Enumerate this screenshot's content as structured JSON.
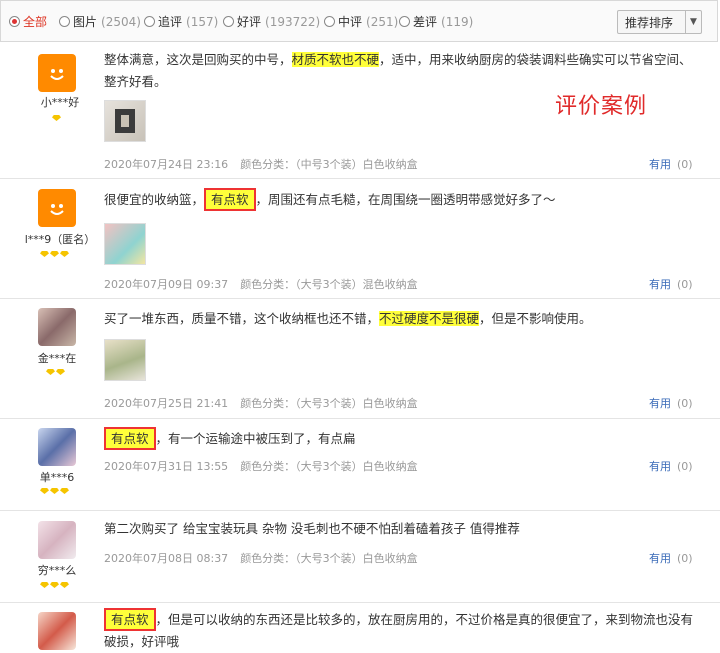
{
  "filters": [
    {
      "label": "全部",
      "count": "",
      "selected": true
    },
    {
      "label": "图片",
      "count": "(2504)",
      "selected": false
    },
    {
      "label": "追评",
      "count": "(157)",
      "selected": false
    },
    {
      "label": "好评",
      "count": "(193722)",
      "selected": false
    },
    {
      "label": "中评",
      "count": "(251)",
      "selected": false
    },
    {
      "label": "差评",
      "count": "(119)",
      "selected": false
    }
  ],
  "sort": {
    "label": "推荐排序",
    "arrow": "▼"
  },
  "watermark": "评价案例",
  "reviews": [
    {
      "user": "小***好",
      "stars": 1,
      "text_parts": [
        "整体满意，这次是回购买的中号，",
        "材质不软也不硬",
        "，适中，用来收纳厨房的袋装调料些确实可以节省空间、整齐好看。"
      ],
      "date": "2020年07月24日 23:16",
      "option": "颜色分类：（中号3个装）白色收纳盒",
      "useful": "有用",
      "useful_count": "(0)"
    },
    {
      "user": "l***9（匿名）",
      "stars": 3,
      "text_parts": [
        "很便宜的收纳篮，",
        "有点软",
        "，周围还有点毛糙，在周围绕一圈透明带感觉好多了～"
      ],
      "date": "2020年07月09日 09:37",
      "option": "颜色分类：（大号3个装）混色收纳盒",
      "useful": "有用",
      "useful_count": "(0)"
    },
    {
      "user": "金***在",
      "stars": 2,
      "text_parts": [
        "买了一堆东西，质量不错，这个收纳框也还不错，",
        "不过硬度不是很硬",
        "，但是不影响使用。"
      ],
      "date": "2020年07月25日 21:41",
      "option": "颜色分类：（大号3个装）白色收纳盒",
      "useful": "有用",
      "useful_count": "(0)"
    },
    {
      "user": "单***6",
      "stars": 3,
      "text_parts": [
        "",
        "有点软",
        "，有一个运输途中被压到了，有点扁"
      ],
      "date": "2020年07月31日 13:55",
      "option": "颜色分类：（大号3个装）白色收纳盒",
      "useful": "有用",
      "useful_count": "(0)"
    },
    {
      "user": "穷***么",
      "stars": 3,
      "text_parts": [
        "第二次购买了 给宝宝装玩具 杂物 没毛刺也不硬不怕刮着磕着孩子 值得推荐",
        "",
        ""
      ],
      "date": "2020年07月08日 08:37",
      "option": "颜色分类：（大号3个装）白色收纳盒",
      "useful": "有用",
      "useful_count": "(0)"
    },
    {
      "user": "",
      "stars": 0,
      "text_parts": [
        "",
        "有点软",
        "，但是可以收纳的东西还是比较多的，放在厨房用的，不过价格是真的很便宜了，来到物流也没有破损，好评哦"
      ],
      "date": "",
      "option": "",
      "useful": "",
      "useful_count": ""
    }
  ]
}
